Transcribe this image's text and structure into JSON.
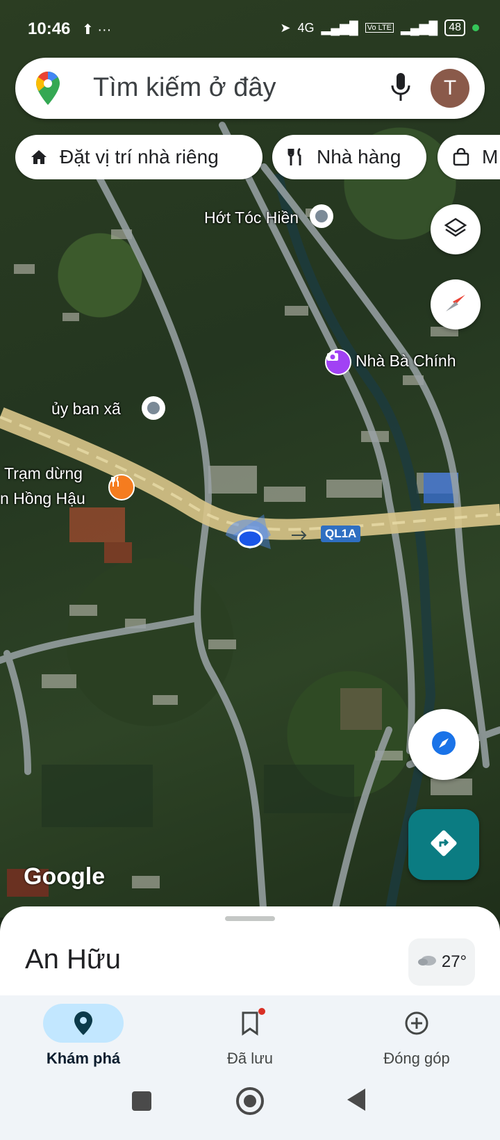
{
  "status_bar": {
    "time": "10:46",
    "network": "4G",
    "volte": "Vo LTE",
    "battery": "48"
  },
  "search": {
    "placeholder": "Tìm kiếm ở đây",
    "avatar_letter": "T"
  },
  "chips": [
    {
      "label": "Đặt vị trí nhà riêng",
      "icon": "home-icon"
    },
    {
      "label": "Nhà hàng",
      "icon": "restaurant-icon"
    },
    {
      "label": "M",
      "icon": "shopping-bag-icon"
    }
  ],
  "map": {
    "labels": {
      "hot_toc": "Hớt Tóc Hiền",
      "nha_ba_chinh": "Nhà Bà Chính",
      "uy_ban": "ủy ban xã",
      "tram_dung_1": "Trạm dừng",
      "tram_dung_2": "n Hồng Hậu",
      "road": "QL1A"
    },
    "watermark": "Google"
  },
  "sheet": {
    "place": "An Hữu",
    "temperature": "27°"
  },
  "nav": [
    {
      "label": "Khám phá",
      "icon": "explore-pin-icon",
      "active": true
    },
    {
      "label": "Đã lưu",
      "icon": "bookmark-icon",
      "active": false
    },
    {
      "label": "Đóng góp",
      "icon": "add-circle-icon",
      "active": false
    }
  ]
}
